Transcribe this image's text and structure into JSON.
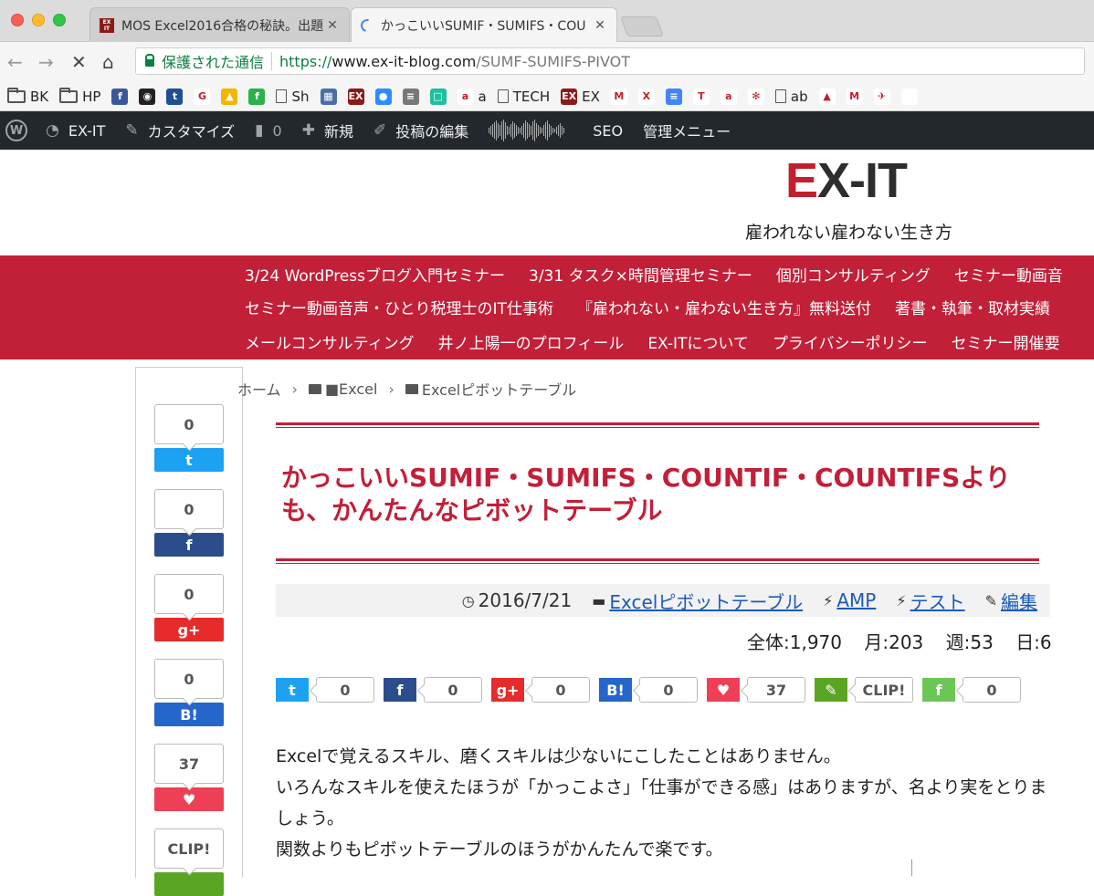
{
  "browser": {
    "tabs": [
      {
        "title": "MOS Excel2016合格の秘訣。出題",
        "close": "✕",
        "active": false
      },
      {
        "title": "かっこいいSUMIF・SUMIFS・COU",
        "close": "✕",
        "active": true
      }
    ],
    "secure_label": "保護された通信",
    "url": {
      "scheme": "https://",
      "host": "www.ex-it-blog.com",
      "path": "/SUMF-SUMIFS-PIVOT"
    }
  },
  "bookmarks": [
    {
      "label": "BK",
      "icon": "folder-icon"
    },
    {
      "label": "HP",
      "icon": "folder-icon"
    },
    {
      "label": "",
      "icon": "facebook-icon",
      "color": "#3b5998",
      "glyph": "f"
    },
    {
      "label": "",
      "icon": "hootsuite-icon",
      "color": "#222",
      "glyph": "◉"
    },
    {
      "label": "",
      "icon": "twitter-bird-icon",
      "color": "#1d4f91",
      "glyph": "t"
    },
    {
      "label": "",
      "icon": "google-icon",
      "color": "#fff",
      "glyph": "G"
    },
    {
      "label": "",
      "icon": "drive-icon",
      "color": "#f4b400",
      "glyph": "▲"
    },
    {
      "label": "",
      "icon": "feedly-icon",
      "color": "#2bb24c",
      "glyph": "f"
    },
    {
      "label": "Sh",
      "icon": "page-icon"
    },
    {
      "label": "",
      "icon": "calendar-icon",
      "color": "#4a6fa5",
      "glyph": "▦"
    },
    {
      "label": "",
      "icon": "ex-it-icon",
      "color": "#8b1a1a",
      "glyph": "EX"
    },
    {
      "label": "",
      "icon": "zoom-icon",
      "color": "#2d8cff",
      "glyph": "●"
    },
    {
      "label": "",
      "icon": "news-icon",
      "color": "#777",
      "glyph": "≡"
    },
    {
      "label": "",
      "icon": "evernote-square-icon",
      "color": "#1fbfa0",
      "glyph": "□"
    },
    {
      "label": "a",
      "icon": "amazon-icon",
      "color": "#fff",
      "glyph": "a"
    },
    {
      "label": "TECH",
      "icon": "page-icon"
    },
    {
      "label": "EX",
      "icon": "ex-it-icon",
      "color": "#8b1a1a",
      "glyph": "EX"
    },
    {
      "label": "",
      "icon": "gmail-icon",
      "color": "#fff",
      "glyph": "M"
    },
    {
      "label": "",
      "icon": "x-icon",
      "color": "#fff",
      "glyph": "X"
    },
    {
      "label": "",
      "icon": "docs-icon",
      "color": "#4285f4",
      "glyph": "≡"
    },
    {
      "label": "",
      "icon": "typetalk-icon",
      "color": "#fff",
      "glyph": "T"
    },
    {
      "label": "",
      "icon": "amazon-icon",
      "color": "#fff",
      "glyph": "a"
    },
    {
      "label": "",
      "icon": "photos-icon",
      "color": "#fff",
      "glyph": "✻"
    },
    {
      "label": "ab",
      "icon": "page-icon"
    },
    {
      "label": "",
      "icon": "google-drive-icon",
      "color": "#fff",
      "glyph": "▲"
    },
    {
      "label": "",
      "icon": "mf-icon",
      "color": "#fff",
      "glyph": "M"
    },
    {
      "label": "",
      "icon": "airplane-icon",
      "color": "#fff",
      "glyph": "✈"
    },
    {
      "label": "",
      "icon": "apple-icon",
      "color": "#fff",
      "glyph": ""
    }
  ],
  "adminbar": {
    "site": "EX-IT",
    "customize": "カスタマイズ",
    "comments": "0",
    "new": "新規",
    "edit": "投稿の編集",
    "seo": "SEO",
    "admin_menu": "管理メニュー"
  },
  "site": {
    "logo": "EX-IT",
    "tagline": "雇われない雇わない生き方"
  },
  "menu": {
    "row1": [
      "3/24 WordPressブログ入門セミナー",
      "3/31 タスク×時間管理セミナー",
      "個別コンサルティング",
      "セミナー動画音"
    ],
    "row2": [
      "セミナー動画音声・ひとり税理士のIT仕事術",
      "『雇われない・雇わない生き方』無料送付",
      "著書・執筆・取材実績"
    ],
    "row3": [
      "メールコンサルティング",
      "井ノ上陽一のプロフィール",
      "EX-ITについて",
      "プライバシーポリシー",
      "セミナー開催要"
    ]
  },
  "sidebar_share": [
    {
      "count": "0",
      "label": "t",
      "icon": "twitter-icon",
      "color": "#1da1f2"
    },
    {
      "count": "0",
      "label": "f",
      "icon": "facebook-icon",
      "color": "#2b4d8c"
    },
    {
      "count": "0",
      "label": "g+",
      "icon": "google-plus-icon",
      "color": "#e62b2b"
    },
    {
      "count": "0",
      "label": "B!",
      "icon": "hatena-bookmark-icon",
      "color": "#2466c9"
    },
    {
      "count": "37",
      "label": "♥",
      "icon": "pocket-icon",
      "color": "#ef3f56"
    },
    {
      "count": "CLIP!",
      "label": "",
      "icon": "evernote-icon",
      "color": "#5ba525"
    }
  ],
  "breadcrumb": {
    "home": "ホーム",
    "cat1": "■Excel",
    "cat2": "Excelピボットテーブル",
    "sep": "›"
  },
  "post": {
    "title": "かっこいいSUMIF・SUMIFS・COUNTIF・COUNTIFSよりも、かんたんなピボットテーブル",
    "date": "2016/7/21",
    "category": "Excelピボットテーブル",
    "amp": "AMP",
    "test": "テスト",
    "edit": "編集",
    "counts": {
      "total": "全体:1,970",
      "month": "月:203",
      "week": "週:53",
      "day": "日:6"
    },
    "body": [
      "Excelで覚えるスキル、磨くスキルは少ないにこしたことはありません。",
      "いろんなスキルを使えたほうが「かっこよさ」「仕事ができる感」はありますが、名より実をとりましょう。",
      "関数よりもピボットテーブルのほうがかんたんで楽です。"
    ]
  },
  "share_row": [
    {
      "label": "t",
      "count": "0",
      "icon": "twitter-icon",
      "color": "#1da1f2"
    },
    {
      "label": "f",
      "count": "0",
      "icon": "facebook-icon",
      "color": "#2b4d8c"
    },
    {
      "label": "g+",
      "count": "0",
      "icon": "google-plus-icon",
      "color": "#e62b2b"
    },
    {
      "label": "B!",
      "count": "0",
      "icon": "hatena-bookmark-icon",
      "color": "#2466c9"
    },
    {
      "label": "♥",
      "count": "37",
      "icon": "pocket-icon",
      "color": "#ef3f56"
    },
    {
      "label": "✎",
      "count": "CLIP!",
      "icon": "evernote-icon",
      "color": "#5ba525"
    },
    {
      "label": "f",
      "count": "0",
      "icon": "feedly-icon",
      "color": "#6cc655"
    }
  ]
}
